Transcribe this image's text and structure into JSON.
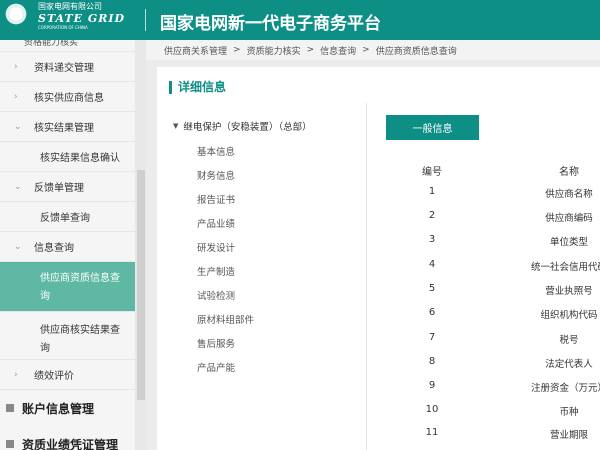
{
  "header": {
    "logo_cn": "国家电网有限公司",
    "logo_en": "STATE GRID",
    "logo_sub": "CORPORATION OF CHINA",
    "title": "国家电网新一代电子商务平台",
    "bg_color": "#0e8f86"
  },
  "sidebar": {
    "top_partial": "资格能力核实",
    "items": [
      {
        "label": "资料递交管理",
        "chev": "›"
      },
      {
        "label": "核实供应商信息",
        "chev": "›"
      },
      {
        "label": "核实结果管理",
        "chev": "⌄"
      }
    ],
    "sub_confirm": "核实结果信息确认",
    "feedback": {
      "label": "反馈单管理",
      "chev": "⌄"
    },
    "sub_feedback_query": "反馈单查询",
    "info_query": {
      "label": "信息查询",
      "chev": "⌄"
    },
    "active_item": "供应商资质信息查询",
    "sub_verify_query": "供应商核实结果查询",
    "perf": {
      "label": "绩效评价",
      "chev": "›"
    },
    "groups": [
      "账户信息管理",
      "资质业绩凭证管理"
    ],
    "active_color": "#5eb8a3"
  },
  "breadcrumb": [
    "供应商关系管理",
    "资质能力核实",
    "信息查询",
    "供应商资质信息查询"
  ],
  "breadcrumb_sep": ">",
  "panel": {
    "title": "详细信息",
    "tree": {
      "root": "继电保护（安稳装置）（总部）",
      "children": [
        "基本信息",
        "财务信息",
        "报告证书",
        "产品业绩",
        "研发设计",
        "生产制造",
        "试验检测",
        "原材料组部件",
        "售后服务",
        "产品产能"
      ]
    },
    "tab": "一般信息",
    "table": {
      "col_num": "编号",
      "col_name": "名称",
      "rows": [
        {
          "num": "1",
          "name": "供应商名称"
        },
        {
          "num": "2",
          "name": "供应商编码"
        },
        {
          "num": "3",
          "name": "单位类型"
        },
        {
          "num": "4",
          "name": "统一社会信用代码"
        },
        {
          "num": "5",
          "name": "营业执照号"
        },
        {
          "num": "6",
          "name": "组织机构代码"
        },
        {
          "num": "7",
          "name": "税号"
        },
        {
          "num": "8",
          "name": "法定代表人"
        },
        {
          "num": "9",
          "name": "注册资金（万元）"
        },
        {
          "num": "10",
          "name": "币种"
        },
        {
          "num": "11",
          "name": "营业期限"
        }
      ]
    }
  }
}
